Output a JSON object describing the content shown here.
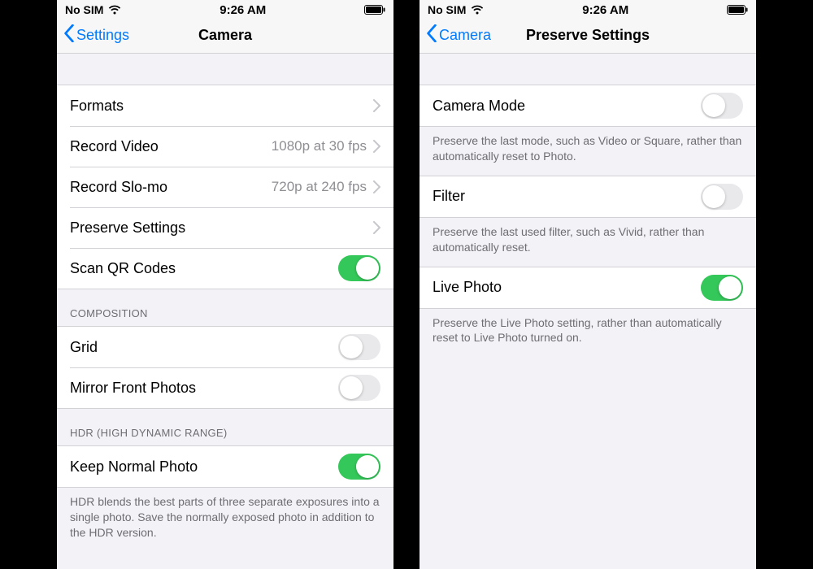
{
  "statusbar": {
    "carrier": "No SIM",
    "time": "9:26 AM"
  },
  "left": {
    "back_label": "Settings",
    "title": "Camera",
    "rows": {
      "formats": "Formats",
      "record_video": {
        "label": "Record Video",
        "value": "1080p at 30 fps"
      },
      "record_slomo": {
        "label": "Record Slo-mo",
        "value": "720p at 240 fps"
      },
      "preserve_settings": "Preserve Settings",
      "scan_qr": "Scan QR Codes"
    },
    "sections": {
      "composition": "COMPOSITION",
      "grid": "Grid",
      "mirror_front": "Mirror Front Photos",
      "hdr_header": "HDR (HIGH DYNAMIC RANGE)",
      "keep_normal": "Keep Normal Photo",
      "hdr_footer": "HDR blends the best parts of three separate exposures into a single photo. Save the normally exposed photo in addition to the HDR version."
    }
  },
  "right": {
    "back_label": "Camera",
    "title": "Preserve Settings",
    "camera_mode": {
      "label": "Camera Mode",
      "footer": "Preserve the last mode, such as Video or Square, rather than automatically reset to Photo."
    },
    "filter": {
      "label": "Filter",
      "footer": "Preserve the last used filter, such as Vivid, rather than automatically reset."
    },
    "live_photo": {
      "label": "Live Photo",
      "footer": "Preserve the Live Photo setting, rather than automatically reset to Live Photo turned on."
    }
  }
}
